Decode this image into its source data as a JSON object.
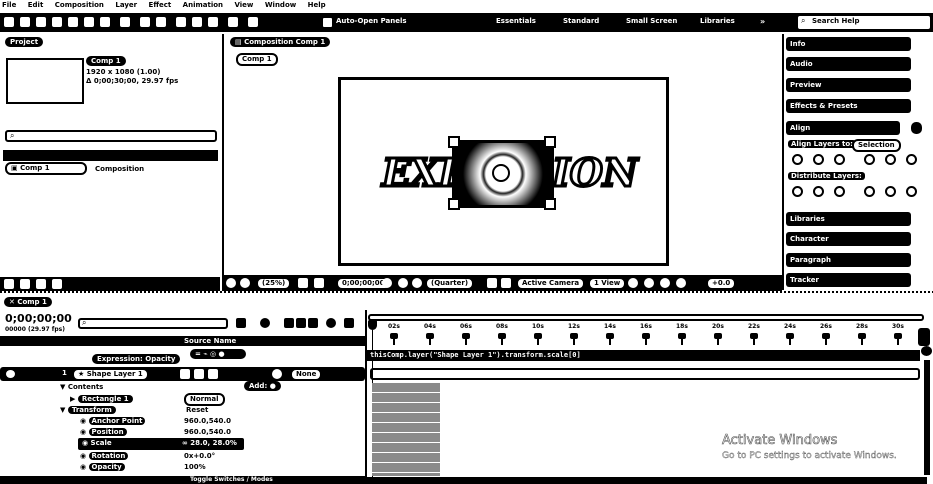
{
  "menu": [
    "File",
    "Edit",
    "Composition",
    "Layer",
    "Effect",
    "Animation",
    "View",
    "Window",
    "Help"
  ],
  "toolbar": {
    "auto_open_panels": "Auto-Open Panels",
    "workspaces": [
      "Essentials",
      "Standard",
      "Small Screen",
      "Libraries"
    ],
    "search_help": "Search Help"
  },
  "project": {
    "tab": "Project",
    "comp_name": "Comp 1",
    "comp_size": "1920 x 1080 (1.00)",
    "comp_duration": "Δ 0;00;30;00, 29.97 fps",
    "row": "Comp 1",
    "row_type": "Composition"
  },
  "viewer": {
    "tab": "Composition Comp 1",
    "breadcrumb": "Comp 1",
    "title_left": "EXP",
    "title_right": "ION",
    "zoom": "(25%)",
    "timecode": "0;00;00;00",
    "quality": "(Quarter)",
    "camera": "Active Camera",
    "views": "1 View",
    "exposure": "+0.0"
  },
  "right_panel": {
    "items": [
      "Info",
      "Audio",
      "Preview",
      "Effects & Presets",
      "Align"
    ],
    "align_to_label": "Align Layers to:",
    "align_to_value": "Selection",
    "distribute_label": "Distribute Layers:",
    "lower_items": [
      "Libraries",
      "Character",
      "Paragraph",
      "Tracker"
    ]
  },
  "timeline": {
    "tab": "Comp 1",
    "timecode": "0;00;00;00",
    "frame_info": "00000 (29.97 fps)",
    "source_name_header": "Source Name",
    "expression_label": "Expression: Opacity",
    "layer_number": "1",
    "layer_name": "Shape Layer 1",
    "contents": "Contents",
    "add_label": "Add:",
    "rectangle": "Rectangle 1",
    "blend_mode": "Normal",
    "transform": "Transform",
    "reset": "Reset",
    "props": [
      "Anchor Point",
      "Position",
      "Scale",
      "Rotation",
      "Opacity"
    ],
    "scale_value": "∞ 28.0, 28.0%",
    "prop_values": [
      "960.0,540.0",
      "960.0,540.0",
      "0x+0.0°",
      "100%"
    ],
    "parent_none": "None",
    "expression_text": "thisComp.layer(\"Shape Layer 1\").transform.scale[0]",
    "toggle_switches": "Toggle Switches / Modes"
  },
  "ruler": [
    "02s",
    "04s",
    "06s",
    "08s",
    "10s",
    "12s",
    "14s",
    "16s",
    "18s",
    "20s",
    "22s",
    "24s",
    "26s",
    "28s",
    "30s"
  ],
  "watermark": {
    "title": "Activate Windows",
    "subtitle": "Go to PC settings to activate Windows."
  }
}
